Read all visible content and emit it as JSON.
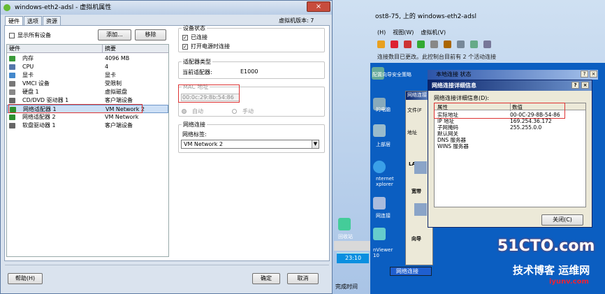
{
  "console": {
    "title": "ost8-75, 上的 windows-eth2-adsl",
    "menu": [
      "(H)",
      "视图(W)",
      "虚拟机(V)"
    ],
    "notice": "连接数目已更改。此控制台目前有 2 个活动连接",
    "bottom_left": "完成时间"
  },
  "guest": {
    "desktop_labels": [
      "配置向导",
      "安全策略",
      "的电脑",
      "上部居",
      "nternet xplorer",
      "网连接",
      "回收站",
      "nViewer 10",
      "网络连接",
      "文件(F",
      "地址",
      "LAN",
      "宽带",
      "向导"
    ],
    "clock": "23:10",
    "status_window_title": "本地连接 状态",
    "net_window_title": "网络连接"
  },
  "dialog": {
    "title": "windows-eth2-adsl - 虚拟机属性",
    "tabs": [
      "硬件",
      "选项",
      "资源"
    ],
    "vm_version": "虚拟机版本: 7",
    "show_all": "显示所有设备",
    "add_button": "添加...",
    "remove_button": "移除",
    "columns": [
      "硬件",
      "摘要"
    ],
    "hardware": [
      {
        "name": "内存",
        "summary": "4096 MB",
        "color": "#3a9a3a"
      },
      {
        "name": "CPU",
        "summary": "4",
        "color": "#5577aa"
      },
      {
        "name": "显卡",
        "summary": "显卡",
        "color": "#4488cc"
      },
      {
        "name": "VMCI 设备",
        "summary": "受限制",
        "color": "#777777"
      },
      {
        "name": "硬盘 1",
        "summary": "虚拟磁盘",
        "color": "#888888"
      },
      {
        "name": "CD/DVD 驱动器 1",
        "summary": "客户端设备",
        "color": "#666666"
      },
      {
        "name": "网络适配器 1",
        "summary": "VM Network 2",
        "color": "#2f8f2f"
      },
      {
        "name": "网络适配器 2",
        "summary": "VM Network",
        "color": "#2f8f2f"
      },
      {
        "name": "软盘驱动器 1",
        "summary": "客户端设备",
        "color": "#666666"
      }
    ],
    "selected_index": 6,
    "device_status": {
      "legend": "设备状态",
      "connected": "已连接",
      "connect_at_power_on": "打开电源时连接"
    },
    "adapter_type": {
      "legend": "适配器类型",
      "current_label": "当前适配器:",
      "current_value": "E1000"
    },
    "mac": {
      "legend": "MAC 地址",
      "value": "00:0c:29:8b:54:86",
      "auto": "自动",
      "manual": "手动"
    },
    "network": {
      "legend": "网络连接",
      "label": "网络标签:",
      "selected": "VM Network 2"
    },
    "help_button": "帮助(H)",
    "ok_button": "确定",
    "cancel_button": "取消"
  },
  "detail": {
    "title": "网络连接详细信息",
    "subtitle": "网络连接详细信息(D):",
    "columns": [
      "属性",
      "数值"
    ],
    "rows": [
      {
        "k": "实际地址",
        "v": "00-0C-29-8B-54-86"
      },
      {
        "k": "IP 地址",
        "v": "169.254.36.172"
      },
      {
        "k": "子网掩码",
        "v": "255.255.0.0"
      },
      {
        "k": "默认网关",
        "v": ""
      },
      {
        "k": "DNS 服务器",
        "v": ""
      },
      {
        "k": "WINS 服务器",
        "v": ""
      }
    ],
    "close_button": "关闭(C)"
  },
  "watermark": {
    "line1": "51CTO.com",
    "line2": "技术博客 运维网",
    "line3": "iyunv.com"
  }
}
